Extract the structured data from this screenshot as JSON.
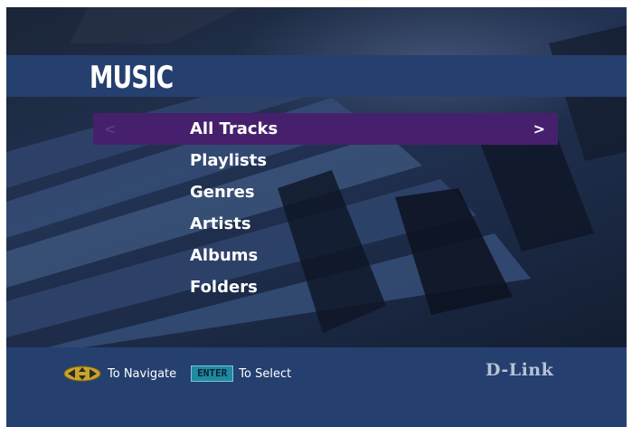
{
  "screen": {
    "title": "MUSIC",
    "menu_items": [
      {
        "label": "All Tracks"
      },
      {
        "label": "Playlists"
      },
      {
        "label": "Genres"
      },
      {
        "label": "Artists"
      },
      {
        "label": "Albums"
      },
      {
        "label": "Folders"
      }
    ],
    "selected_index": 0,
    "arrows": {
      "left": "<",
      "right": ">"
    }
  },
  "footer": {
    "navigate_label": "To Navigate",
    "enter_key_label": "ENTER",
    "select_label": "To Select",
    "brand": "D-Link"
  },
  "icons": {
    "navigate": "dpad-arrows-icon"
  },
  "colors": {
    "band": "#25406f",
    "selected": "#47206d",
    "enter_key": "#1f8aa0"
  }
}
